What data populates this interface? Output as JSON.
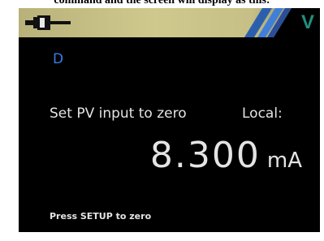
{
  "caption": {
    "text": "command and the screen will display as this:"
  },
  "status_bar": {
    "icon": "plug-icon",
    "mode_letter": "V",
    "mode_color": "#1f8f7f",
    "bar_color": "#ccc68a"
  },
  "display": {
    "indicator": "D",
    "indicator_color": "#3b7ce6",
    "prompt": "Set PV input to zero",
    "local_label": "Local:",
    "reading_value": "8.300",
    "reading_unit": "mA",
    "hint": "Press SETUP to zero",
    "text_color": "#e4e4e4",
    "background": "#000000"
  }
}
